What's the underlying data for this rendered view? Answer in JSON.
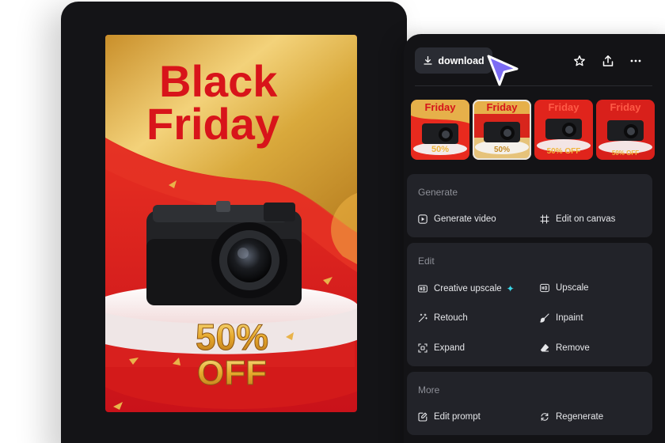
{
  "poster": {
    "headline_line1": "Black",
    "headline_line2": "Friday",
    "offer_line1": "50%",
    "offer_line2": "OFF"
  },
  "toolbar": {
    "download_label": "download",
    "icons": [
      "star-icon",
      "share-icon",
      "more-icon"
    ]
  },
  "thumbnails": {
    "heading": "Friday",
    "offers": [
      "50%",
      "50%",
      "50% OFF",
      "50% OFF"
    ],
    "selected_index": 1
  },
  "generate": {
    "title": "Generate",
    "generate_video": "Generate video",
    "edit_on_canvas": "Edit on canvas"
  },
  "edit": {
    "title": "Edit",
    "creative_upscale": "Creative upscale",
    "upscale": "Upscale",
    "retouch": "Retouch",
    "inpaint": "Inpaint",
    "expand": "Expand",
    "remove": "Remove"
  },
  "more": {
    "title": "More",
    "edit_prompt": "Edit prompt",
    "regenerate": "Regenerate"
  },
  "colors": {
    "panel_bg": "#131316",
    "section_bg": "#222329",
    "accent_cursor": "#7c6cf4",
    "sparkle": "#3ad7e8",
    "poster_red": "#e01f1f",
    "poster_gold": "#d9a93c"
  }
}
